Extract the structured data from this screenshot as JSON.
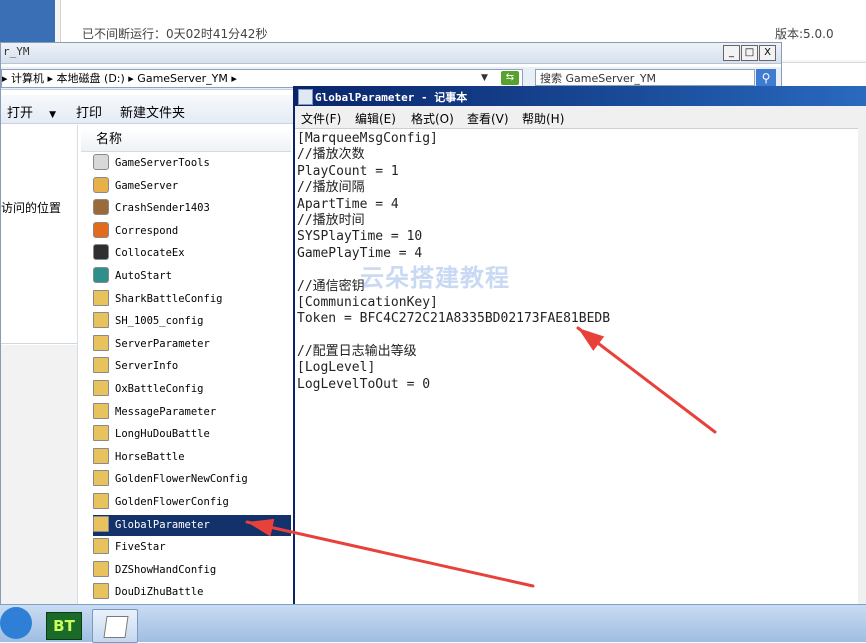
{
  "status_window": {
    "uptime": "已不间断运行：0天02时41分42秒",
    "version": "版本:5.0.0"
  },
  "explorer": {
    "title": "r_YM",
    "controls": {
      "minimize": "_",
      "maximize": "□",
      "close": "X"
    },
    "address": "▸ 计算机 ▸ 本地磁盘 (D:) ▸ GameServer_YM ▸",
    "search_placeholder": "搜索 GameServer_YM",
    "toolbar": {
      "open": "打开",
      "print": "打印",
      "new_folder": "新建文件夹"
    },
    "nav_text": "访问的位置",
    "column_name": "名称",
    "files": [
      {
        "name": "GameServerTools",
        "icon": "folder-icon",
        "color": "#d8d8d8"
      },
      {
        "name": "GameServer",
        "icon": "exe-icon",
        "color": "#e8b04a"
      },
      {
        "name": "CrashSender1403",
        "icon": "exe-icon",
        "color": "#9a6a3a"
      },
      {
        "name": "Correspond",
        "icon": "exe-icon",
        "color": "#e36b1e"
      },
      {
        "name": "CollocateEx",
        "icon": "exe-icon",
        "color": "#2f2f2f"
      },
      {
        "name": "AutoStart",
        "icon": "exe-icon",
        "color": "#2f8f8a"
      },
      {
        "name": "SharkBattleConfig",
        "icon": "config-file-icon",
        "color": "#e8c25c"
      },
      {
        "name": "SH_1005_config",
        "icon": "config-file-icon",
        "color": "#e8c25c"
      },
      {
        "name": "ServerParameter",
        "icon": "config-file-icon",
        "color": "#e8c25c"
      },
      {
        "name": "ServerInfo",
        "icon": "config-file-icon",
        "color": "#e8c25c"
      },
      {
        "name": "OxBattleConfig",
        "icon": "config-file-icon",
        "color": "#e8c25c"
      },
      {
        "name": "MessageParameter",
        "icon": "config-file-icon",
        "color": "#e8c25c"
      },
      {
        "name": "LongHuDouBattle",
        "icon": "config-file-icon",
        "color": "#e8c25c"
      },
      {
        "name": "HorseBattle",
        "icon": "config-file-icon",
        "color": "#e8c25c"
      },
      {
        "name": "GoldenFlowerNewConfig",
        "icon": "config-file-icon",
        "color": "#e8c25c"
      },
      {
        "name": "GoldenFlowerConfig",
        "icon": "config-file-icon",
        "color": "#e8c25c"
      },
      {
        "name": "GlobalParameter",
        "icon": "config-file-icon",
        "color": "#e8c25c",
        "selected": true
      },
      {
        "name": "FiveStar",
        "icon": "config-file-icon",
        "color": "#e8c25c"
      },
      {
        "name": "DZShowHandConfig",
        "icon": "config-file-icon",
        "color": "#e8c25c"
      },
      {
        "name": "DouDiZhuBattle",
        "icon": "config-file-icon",
        "color": "#e8c25c"
      }
    ]
  },
  "notepad": {
    "title": "GlobalParameter - 记事本",
    "menu": [
      "文件(F)",
      "编辑(E)",
      "格式(O)",
      "查看(V)",
      "帮助(H)"
    ],
    "lines": [
      "[MarqueeMsgConfig]",
      "//播放次数",
      "PlayCount = 1",
      "//播放间隔",
      "ApartTime = 4",
      "//播放时间",
      "SYSPlayTime = 10",
      "GamePlayTime = 4",
      "",
      "//通信密钥",
      "[CommunicationKey]",
      "Token = BFC4C272C21A8335BD02173FAE81BEDB",
      "",
      "//配置日志输出等级",
      "[LogLevel]",
      "LogLevelToOut = 0"
    ],
    "watermark": "云朵搭建教程"
  },
  "taskbar": {
    "bt_label": "BT"
  },
  "annotation_color": "#e8413a"
}
